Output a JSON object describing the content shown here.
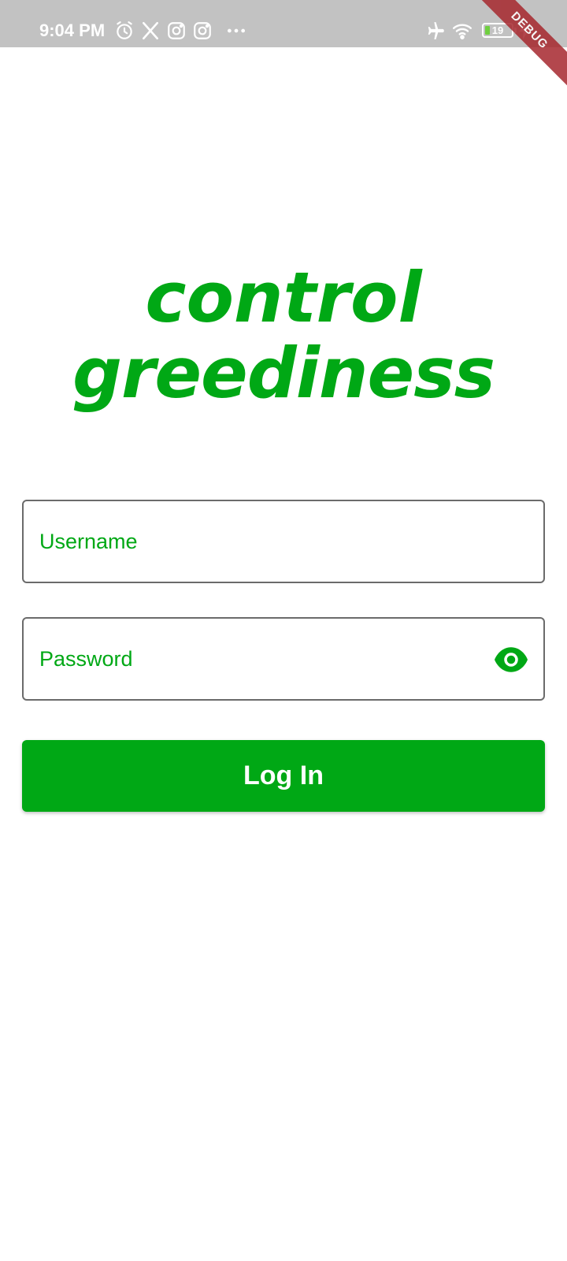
{
  "status_bar": {
    "time": "9:04 PM",
    "battery_level": "19",
    "battery_fraction": 0.19,
    "icons": [
      "alarm-icon",
      "x-icon",
      "instagram-icon",
      "instagram-icon",
      "more-dots-icon",
      "airplane-icon",
      "wifi-icon",
      "battery-icon",
      "charging-icon"
    ],
    "debug_label": "DEBUG"
  },
  "logo": {
    "line_1": "control",
    "line_2": "greediness"
  },
  "form": {
    "username_placeholder": "Username",
    "username_value": "",
    "password_placeholder": "Password",
    "password_value": "",
    "password_toggle_icon": "eye-icon",
    "login_label": "Log In"
  },
  "colors": {
    "brand_green": "#00a815",
    "status_bar": "#c2c2c2",
    "field_border": "#6b6b6b",
    "debug_ribbon": "#a6282e"
  }
}
